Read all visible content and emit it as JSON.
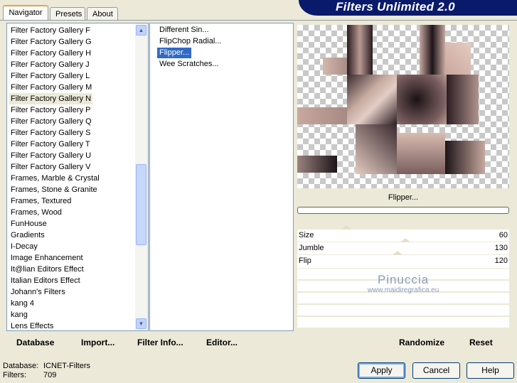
{
  "header": {
    "title": "Filters Unlimited 2.0"
  },
  "tabs": [
    {
      "label": "Navigator",
      "active": true
    },
    {
      "label": "Presets",
      "active": false
    },
    {
      "label": "About",
      "active": false
    }
  ],
  "categories": [
    "Filter Factory Gallery F",
    "Filter Factory Gallery G",
    "Filter Factory Gallery H",
    "Filter Factory Gallery J",
    "Filter Factory Gallery L",
    "Filter Factory Gallery M",
    "Filter Factory Gallery N",
    "Filter Factory Gallery P",
    "Filter Factory Gallery Q",
    "Filter Factory Gallery S",
    "Filter Factory Gallery T",
    "Filter Factory Gallery U",
    "Filter Factory Gallery V",
    "Frames, Marble & Crystal",
    "Frames, Stone & Granite",
    "Frames, Textured",
    "Frames, Wood",
    "FunHouse",
    "Gradients",
    "I-Decay",
    "Image Enhancement",
    "It@lian Editors Effect",
    "Italian Editors Effect",
    "Johann's Filters",
    "kang 4",
    "kang",
    "Lens Effects"
  ],
  "selected_category": "Filter Factory Gallery N",
  "filters": [
    "Different Sin...",
    "FlipChop Radial...",
    "Flipper...",
    "Wee Scratches..."
  ],
  "selected_filter": "Flipper...",
  "left_buttons": {
    "database": "Database",
    "import": "Import...",
    "filter_info": "Filter Info...",
    "editor": "Editor..."
  },
  "preview": {
    "filter_name": "Flipper..."
  },
  "sliders": [
    {
      "label": "Size",
      "value": "60"
    },
    {
      "label": "Jumble",
      "value": "130"
    },
    {
      "label": "Flip",
      "value": "120"
    }
  ],
  "watermark": {
    "line1": "Pinuccia",
    "line2": "www.maidiregrafica.eu"
  },
  "right_buttons": {
    "randomize": "Randomize",
    "reset": "Reset"
  },
  "status": {
    "database_label": "Database:",
    "database_value": "ICNET-Filters",
    "filters_label": "Filters:",
    "filters_value": "709"
  },
  "dialog_buttons": {
    "apply": "Apply",
    "cancel": "Cancel",
    "help": "Help"
  },
  "colors": {
    "banner": "#0a1a6b",
    "selection": "#316ac5",
    "tile_light": "#c9b1a6",
    "tile_dark": "#2a1b20"
  }
}
